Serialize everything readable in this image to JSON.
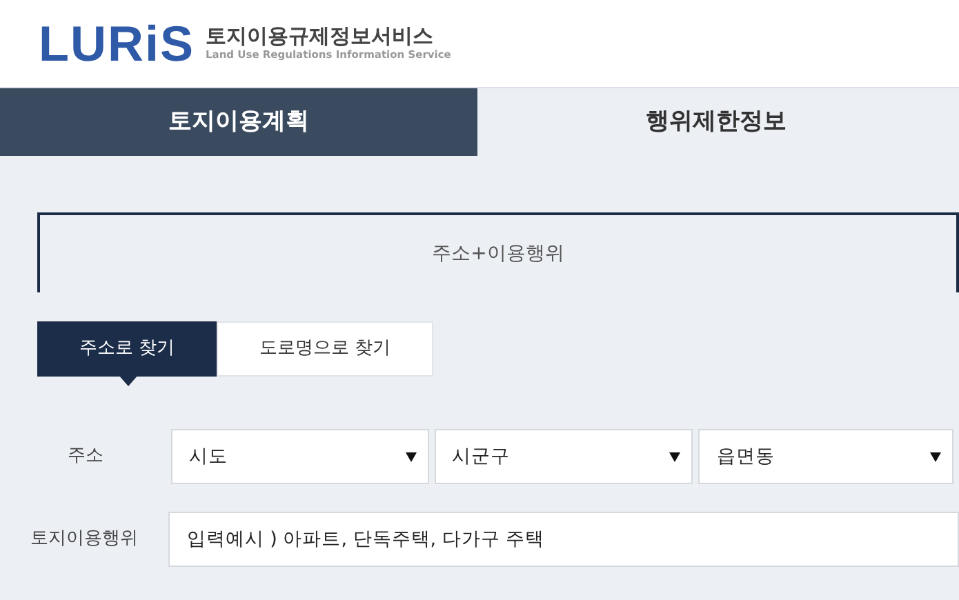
{
  "header": {
    "logo": "LURiS",
    "title": "토지이용규제정보서비스",
    "subtitle": "Land Use Regulations Information Service"
  },
  "main_tabs": [
    {
      "label": "토지이용계획",
      "selected": true
    },
    {
      "label": "행위제한정보",
      "selected": false
    }
  ],
  "section_title": "주소+이용행위",
  "search_tabs": [
    {
      "label": "주소로 찾기",
      "selected": true
    },
    {
      "label": "도로명으로 찾기",
      "selected": false
    }
  ],
  "address": {
    "label": "주소",
    "selects": [
      "시도",
      "시군구",
      "읍면동"
    ]
  },
  "land_use": {
    "label": "토지이용행위",
    "placeholder": "입력예시 ) 아파트, 단독주택, 다가구 주택"
  }
}
